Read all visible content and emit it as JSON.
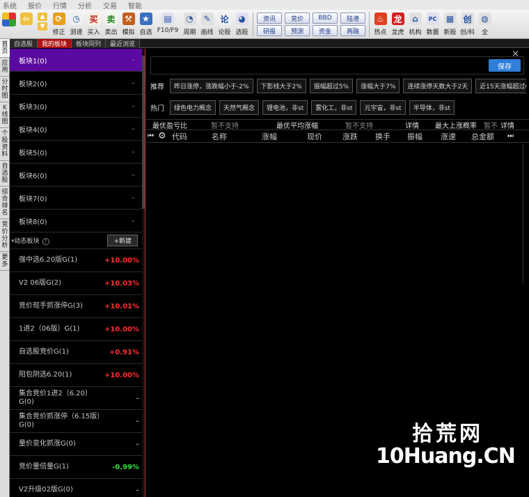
{
  "menu": [
    "系统",
    "报价",
    "行情",
    "分析",
    "交易",
    "智能"
  ],
  "toolbar": {
    "buttons": [
      {
        "label": "修正",
        "icon": "refresh-icon",
        "color": "#e6a020",
        "glyph": "⟳"
      },
      {
        "label": "测速",
        "icon": "clock-icon",
        "color": "#f0f0f0",
        "glyph": "◷"
      },
      {
        "label": "买入",
        "icon": "buy-icon",
        "color": "#f8f0e0",
        "glyph": "买"
      },
      {
        "label": "卖出",
        "icon": "sell-icon",
        "color": "#f0f8e8",
        "glyph": "卖"
      },
      {
        "label": "模拟",
        "icon": "hammer-icon",
        "color": "#c06020",
        "glyph": "⚒"
      },
      {
        "label": "自选",
        "icon": "star-folder-icon",
        "color": "#3a70c0",
        "glyph": "★"
      },
      {
        "label": "F10/F9",
        "icon": "document-icon",
        "color": "#e0e0f0",
        "glyph": "▤"
      },
      {
        "label": "周期",
        "icon": "cycle-icon",
        "color": "#e0e0e0",
        "glyph": "◔"
      },
      {
        "label": "画线",
        "icon": "pen-icon",
        "color": "#e0e0e0",
        "glyph": "✎"
      },
      {
        "label": "论股",
        "icon": "comment-icon",
        "color": "#f0f0f0",
        "glyph": "论"
      },
      {
        "label": "选股",
        "icon": "gauge-icon",
        "color": "#e0e0f0",
        "glyph": "◕"
      }
    ],
    "chips": [
      "资讯",
      "研报",
      "竞价",
      "预测",
      "BBD",
      "资金",
      "陆港",
      "两融"
    ],
    "right_buttons": [
      {
        "label": "热点",
        "icon": "fire-icon",
        "color": "#e04020",
        "glyph": "♨"
      },
      {
        "label": "龙虎",
        "icon": "dragon-icon",
        "color": "#d02020",
        "glyph": "龙"
      },
      {
        "label": "机构",
        "icon": "bank-icon",
        "color": "#e0e0e0",
        "glyph": "⌂"
      },
      {
        "label": "数据",
        "icon": "pc-icon",
        "color": "#e0e0f0",
        "glyph": "PC"
      },
      {
        "label": "新股",
        "icon": "new-stock-icon",
        "color": "#e0e0e0",
        "glyph": "▦"
      },
      {
        "label": "创/科",
        "icon": "chuang-icon",
        "color": "#e0e0e0",
        "glyph": "创"
      },
      {
        "label": "全",
        "icon": "globe-icon",
        "color": "#e0e0e0",
        "glyph": "◍"
      }
    ]
  },
  "tabs": [
    {
      "label": "自选股",
      "active": false
    },
    {
      "label": "我的板块",
      "active": true
    },
    {
      "label": "板块同列",
      "active": false
    },
    {
      "label": "最近浏览",
      "active": false
    }
  ],
  "vtabs": [
    "首页",
    "应用",
    "分时图",
    "K线图",
    "个股资料",
    "自选股",
    "综合排名",
    "竞价分析",
    "更多"
  ],
  "sidebar": {
    "blocks": [
      {
        "name": "板块1(0)",
        "value": "–",
        "selected": true
      },
      {
        "name": "板块2(0)",
        "value": "–"
      },
      {
        "name": "板块3(0)",
        "value": "–"
      },
      {
        "name": "板块4(0)",
        "value": "–"
      },
      {
        "name": "板块5(0)",
        "value": "–"
      },
      {
        "name": "板块6(0)",
        "value": "–"
      },
      {
        "name": "板块7(0)",
        "value": "–"
      },
      {
        "name": "板块8(0)",
        "value": "–"
      }
    ],
    "dynamic_header": "动态板块",
    "new_button": "+新建",
    "dynamic": [
      {
        "name": "强中选6.20版G(1)",
        "pct": "+10.00%",
        "dir": "pos"
      },
      {
        "name": "V2 06版G(2)",
        "pct": "+10.03%",
        "dir": "pos"
      },
      {
        "name": "竞价现手抓涨停G(3)",
        "pct": "+10.01%",
        "dir": "pos"
      },
      {
        "name": "1进2（06版）G(1)",
        "pct": "+10.00%",
        "dir": "pos"
      },
      {
        "name": "自选股竞价G(1)",
        "pct": "+0.91%",
        "dir": "pos"
      },
      {
        "name": "阳包阴选6.20(1)",
        "pct": "+10.00%",
        "dir": "pos"
      },
      {
        "name": "集合竞价1进2（6.20）G(0)",
        "pct": "–",
        "dir": "flat"
      },
      {
        "name": "集合竞价抓涨停（6.15版）G(0)",
        "pct": "–",
        "dir": "flat"
      },
      {
        "name": "量价变化抓涨G(0)",
        "pct": "–",
        "dir": "flat"
      },
      {
        "name": "竞价量倍量G(1)",
        "pct": "-0.99%",
        "dir": "neg"
      },
      {
        "name": "V2升级02版G(0)",
        "pct": "–",
        "dir": "flat"
      }
    ]
  },
  "main": {
    "close": "×",
    "input_value": "",
    "save_label": "保存",
    "recommend_label": "推荐",
    "recommend": [
      "昨日涨停，涨跌幅小于-2%",
      "下影线大于2%",
      "振幅超过5%",
      "涨幅大于7%",
      "连续涨停天数大于2天",
      "近15天涨幅超过6"
    ],
    "hot_label": "热门",
    "hot": [
      "绿色电力概念",
      "天然气概念",
      "锂电池，非st",
      "雾化工，非st",
      "元宇宙，非st",
      "半导体，非st"
    ],
    "subheader": {
      "best_profit": "最优盈亏比",
      "unsupported1": "暂不支持",
      "best_avg": "最优平均涨幅",
      "unsupported2": "暂不支持",
      "detail1": "详情",
      "max_prob": "最大上涨概率",
      "unsupported3": "暂不",
      "detail2": "详情"
    },
    "columns": [
      "代码",
      "名称",
      "涨幅",
      "现价",
      "涨跌",
      "换手",
      "振幅",
      "涨速",
      "总金额"
    ]
  },
  "watermark": {
    "cn": "拾荒网",
    "en": "10Huang.CN"
  }
}
